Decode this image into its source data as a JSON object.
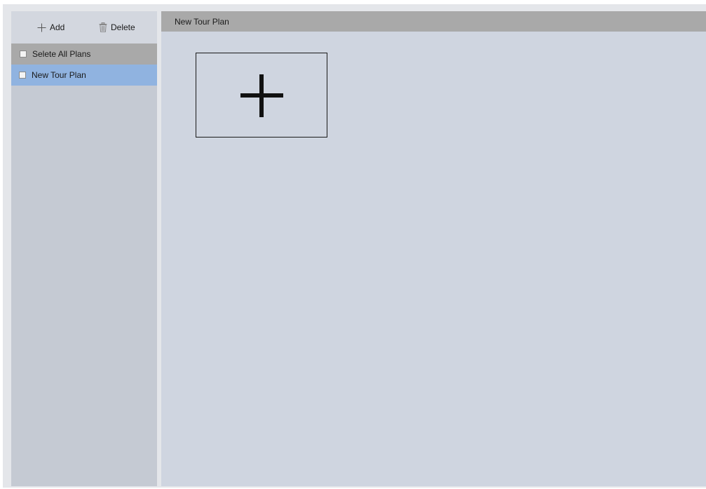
{
  "toolbar": {
    "add_label": "Add",
    "delete_label": "Delete",
    "add_icon": "plus-icon",
    "delete_icon": "trash-icon"
  },
  "plan_list": {
    "select_all_label": "Selete All Plans",
    "select_all_checked": false,
    "items": [
      {
        "label": "New Tour Plan",
        "checked": false,
        "selected": true
      }
    ]
  },
  "main": {
    "title": "New Tour Plan",
    "add_tile_icon": "plus-icon"
  },
  "colors": {
    "selected_row": "#90b3e0",
    "header_bar": "#a9a9a9",
    "sidebar_bg": "#c5cad3",
    "main_bg": "#cfd5e0"
  }
}
